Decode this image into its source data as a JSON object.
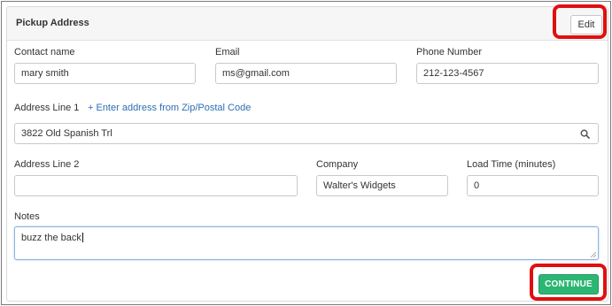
{
  "card": {
    "title": "Pickup Address",
    "edit_label": "Edit"
  },
  "contact": {
    "name_label": "Contact name",
    "name_value": "mary smith",
    "email_label": "Email",
    "email_value": "ms@gmail.com",
    "phone_label": "Phone Number",
    "phone_value": "212-123-4567"
  },
  "address": {
    "line1_label": "Address Line 1",
    "zip_link": "+ Enter address from Zip/Postal Code",
    "line1_value": "3822 Old Spanish Trl",
    "line1_icon": "search-icon",
    "line2_label": "Address Line 2",
    "line2_value": "",
    "company_label": "Company",
    "company_value": "Walter's Widgets",
    "load_time_label": "Load Time (minutes)",
    "load_time_value": "0"
  },
  "notes": {
    "label": "Notes",
    "value": "buzz the back"
  },
  "actions": {
    "continue_label": "CONTINUE"
  },
  "colors": {
    "highlight": "#e01010",
    "continue_bg": "#2bb673",
    "link": "#2e6fb5"
  }
}
